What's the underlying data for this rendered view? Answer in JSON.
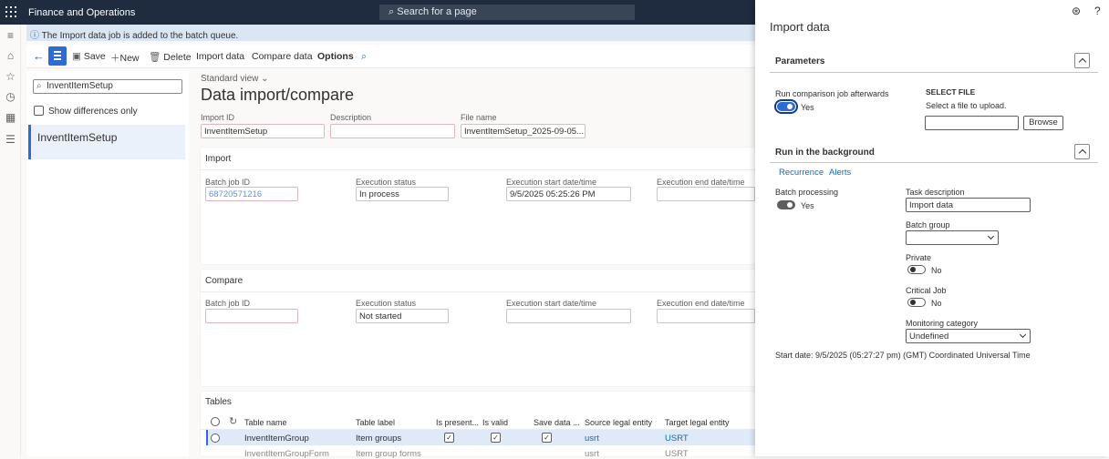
{
  "topbar": {
    "app_title": "Finance and Operations",
    "search_placeholder": "Search for a page"
  },
  "message": "The Import data job is added to the batch queue.",
  "action_pane": {
    "save": "Save",
    "new": "New",
    "delete": "Delete",
    "import_data": "Import data",
    "compare_data": "Compare data",
    "options": "Options"
  },
  "list_panel": {
    "filter_value": "InventItemSetup",
    "show_differences": "Show differences only",
    "selected_item": "InventItemSetup"
  },
  "main": {
    "view": "Standard view",
    "title": "Data import/compare",
    "import_id_label": "Import ID",
    "import_id": "InventItemSetup",
    "description_label": "Description",
    "description": "",
    "file_name_label": "File name",
    "file_name": "InventItemSetup_2025-09-05...",
    "import": {
      "title": "Import",
      "batch_job_id_label": "Batch job ID",
      "batch_job_id": "68720571216",
      "execution_status_label": "Execution status",
      "execution_status": "In process",
      "start_label": "Execution start date/time",
      "start": "9/5/2025 05:25:26 PM",
      "end_label": "Execution end date/time",
      "end": ""
    },
    "compare": {
      "title": "Compare",
      "batch_job_id_label": "Batch job ID",
      "batch_job_id": "",
      "execution_status_label": "Execution status",
      "execution_status": "Not started",
      "start_label": "Execution start date/time",
      "start": "",
      "end_label": "Execution end date/time",
      "end": ""
    },
    "tables": {
      "title": "Tables",
      "columns": [
        "Table name",
        "Table label",
        "Is present...",
        "Is valid",
        "Save data ...",
        "Source legal entity",
        "Target legal entity"
      ],
      "rows": [
        {
          "name": "InventItemGroup",
          "label": "Item groups",
          "source": "usrt",
          "target": "USRT"
        },
        {
          "name": "InventItemGroupForm",
          "label": "Item group forms",
          "source": "usrt",
          "target": "USRT"
        }
      ]
    }
  },
  "dialog": {
    "title": "Import data",
    "parameters": {
      "title": "Parameters",
      "run_comparison_label": "Run comparison job afterwards",
      "run_comparison_value": "Yes",
      "select_file_heading": "SELECT FILE",
      "select_file_hint": "Select a file to upload.",
      "browse": "Browse"
    },
    "background": {
      "title": "Run in the background",
      "tab_recurrence": "Recurrence",
      "tab_alerts": "Alerts",
      "batch_processing_label": "Batch processing",
      "batch_processing_value": "Yes",
      "task_description_label": "Task description",
      "task_description": "Import data",
      "batch_group_label": "Batch group",
      "batch_group": "",
      "private_label": "Private",
      "private_value": "No",
      "critical_job_label": "Critical Job",
      "critical_job_value": "No",
      "monitoring_label": "Monitoring category",
      "monitoring_value": "Undefined",
      "start_date": "Start date: 9/5/2025 (05:27:27 pm) (GMT) Coordinated Universal Time"
    }
  }
}
